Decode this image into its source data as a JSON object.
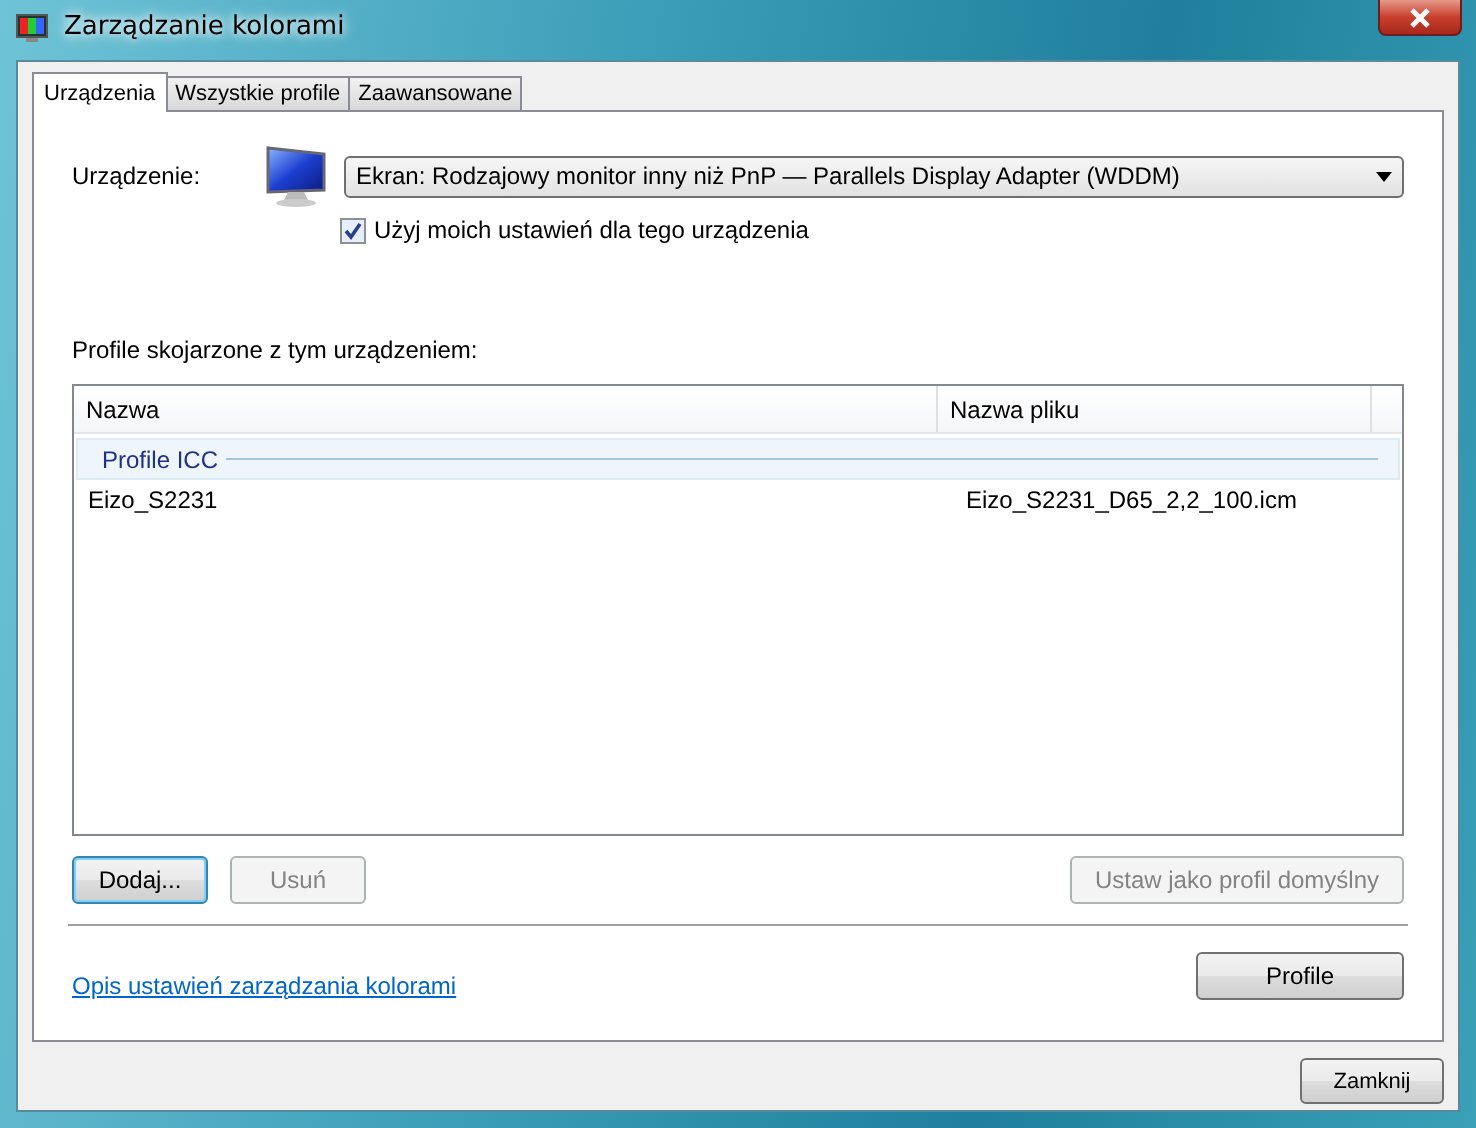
{
  "window": {
    "title": "Zarządzanie kolorami"
  },
  "tabs": [
    {
      "label": "Urządzenia",
      "selected": true
    },
    {
      "label": "Wszystkie profile",
      "selected": false
    },
    {
      "label": "Zaawansowane",
      "selected": false
    }
  ],
  "device": {
    "label": "Urządzenie:",
    "value": "Ekran: Rodzajowy monitor inny niż PnP — Parallels Display Adapter (WDDM)",
    "use_my_settings": {
      "label": "Użyj moich ustawień dla tego urządzenia",
      "checked": true
    }
  },
  "profiles": {
    "label": "Profile skojarzone z tym urządzeniem:",
    "columns": [
      "Nazwa",
      "Nazwa pliku"
    ],
    "groups": [
      {
        "name": "Profile ICC",
        "rows": [
          {
            "name": "Eizo_S2231",
            "file": "Eizo_S2231_D65_2,2_100.icm"
          }
        ]
      }
    ]
  },
  "list_buttons": [
    {
      "label": "Dodaj...",
      "disabled": false,
      "focused": true
    },
    {
      "label": "Usuń",
      "disabled": true,
      "focused": false
    }
  ],
  "default_button": {
    "label": "Ustaw jako profil domyślny",
    "disabled": true
  },
  "link": "Opis ustawień zarządzania kolorami",
  "profile_button": {
    "label": "Profile"
  },
  "close_button": {
    "label": "Zamknij"
  }
}
